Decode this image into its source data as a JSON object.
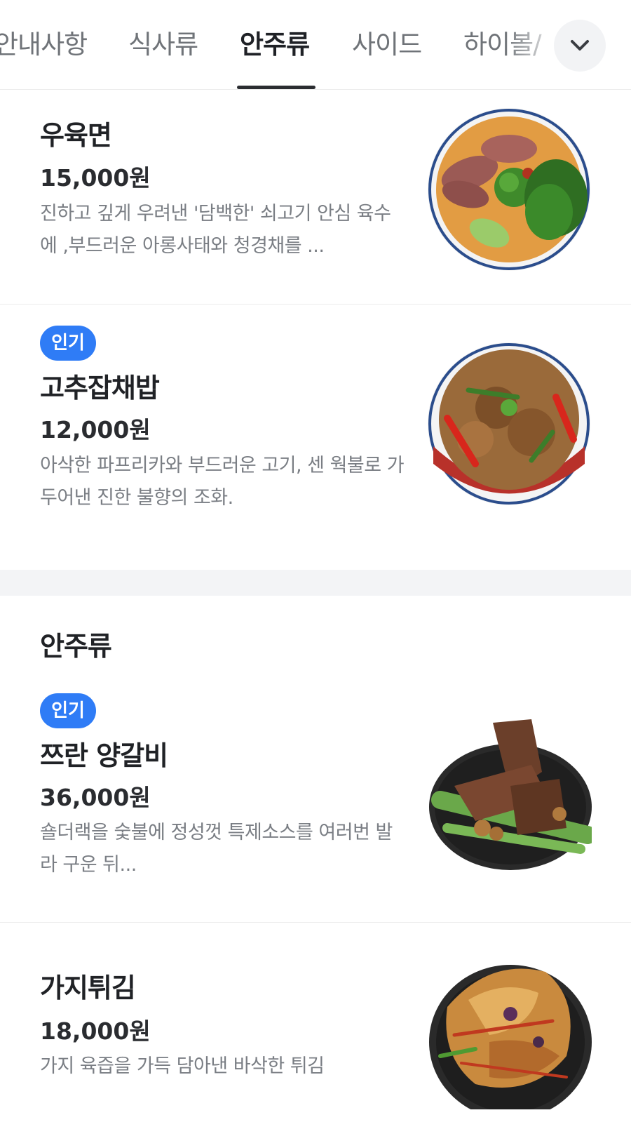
{
  "tabs": [
    {
      "label": "안내사항",
      "active": false
    },
    {
      "label": "식사류",
      "active": false
    },
    {
      "label": "안주류",
      "active": true
    },
    {
      "label": "사이드",
      "active": false
    },
    {
      "label": "하이볼/",
      "active": false
    }
  ],
  "expand_icon": "chevron-down-icon",
  "colors": {
    "badge": "#2f7cf6",
    "active_tab": "#1f2126",
    "inactive_tab": "#6f7378",
    "section_gap": "#f3f4f6"
  },
  "items": [
    {
      "name": "우육면",
      "price": "15,000원",
      "desc": "진하고 깊게 우려낸 '담백한' 쇠고기 안심 육수에 ,부드러운 아롱사태와 청경채를 ...",
      "image": "beef-noodle-soup"
    },
    {
      "badge": "인기",
      "name": "고추잡채밥",
      "price": "12,000원",
      "desc": "아삭한 파프리카와 부드러운 고기, 센 웍불로 가두어낸 진한 불향의 조화.",
      "image": "pepper-japchae-rice"
    }
  ],
  "section": {
    "title": "안주류",
    "items": [
      {
        "badge": "인기",
        "name": "쯔란 양갈비",
        "price": "36,000원",
        "desc": "숄더랙을 숯불에 정성껏 특제소스를 여러번 발라 구운 뒤...",
        "image": "cumin-lamb-ribs"
      },
      {
        "name": "가지튀김",
        "price": "18,000원",
        "desc": "가지 육즙을 가득 담아낸 바삭한 튀김",
        "image": "fried-eggplant"
      }
    ]
  }
}
